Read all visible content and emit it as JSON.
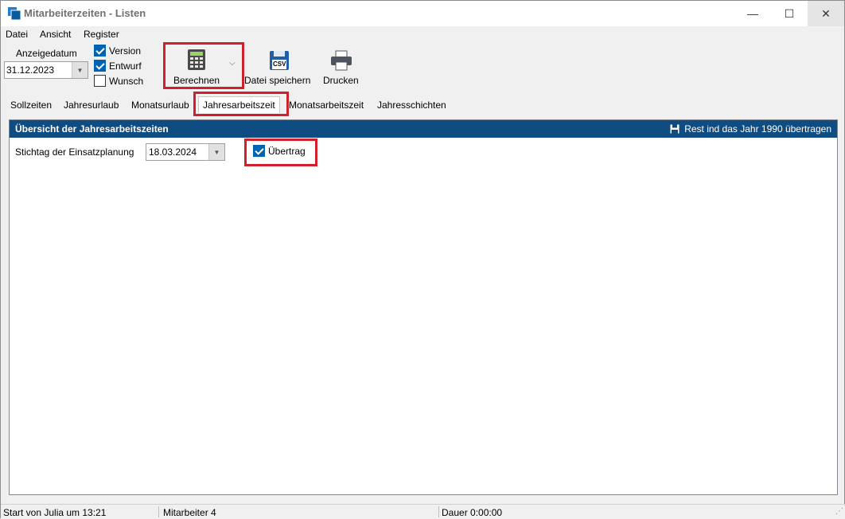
{
  "window": {
    "title": "Mitarbeiterzeiten - Listen",
    "minimize_glyph": "—",
    "maximize_glyph": "☐",
    "close_glyph": "✕"
  },
  "menu": [
    "Datei",
    "Ansicht",
    "Register"
  ],
  "toolbar": {
    "anzeigedatum_label": "Anzeigedatum",
    "anzeigedatum_value": "31.12.2023",
    "checkboxes": [
      {
        "label": "Version",
        "checked": true
      },
      {
        "label": "Entwurf",
        "checked": true
      },
      {
        "label": "Wunsch",
        "checked": false
      }
    ],
    "berechnen_label": "Berechnen",
    "datei_speichern_label": "Datei speichern",
    "drucken_label": "Drucken",
    "csv_badge": "CSV"
  },
  "tabs": [
    {
      "label": "Sollzeiten",
      "active": false
    },
    {
      "label": "Jahresurlaub",
      "active": false
    },
    {
      "label": "Monatsurlaub",
      "active": false
    },
    {
      "label": "Jahresarbeitszeit",
      "active": true
    },
    {
      "label": "Monatsarbeitszeit",
      "active": false
    },
    {
      "label": "Jahresschichten",
      "active": false
    }
  ],
  "panel": {
    "title": "Übersicht der Jahresarbeitszeiten",
    "action_label": "Rest ind das Jahr 1990 übertragen",
    "stichtag_label": "Stichtag der Einsatzplanung",
    "stichtag_value": "18.03.2024",
    "uebertrag_label": "Übertrag",
    "uebertrag_checked": true
  },
  "status": {
    "start": "Start von Julia um 13:21",
    "mitarbeiter": "Mitarbeiter 4",
    "dauer": "Dauer 0:00:00"
  },
  "colors": {
    "header_blue": "#0f4c81",
    "highlight_red": "#d0202c",
    "checkbox_blue": "#0063b1"
  }
}
